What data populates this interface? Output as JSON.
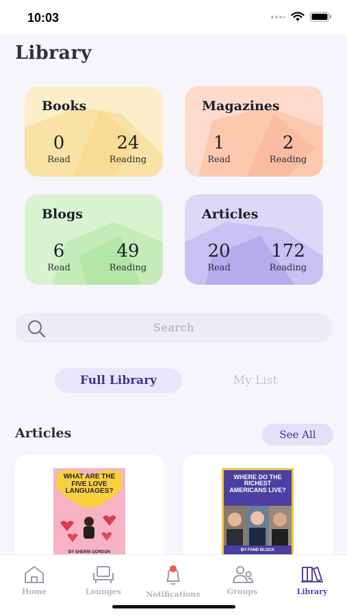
{
  "status": {
    "time": "10:03"
  },
  "page": {
    "title": "Library"
  },
  "cards": [
    {
      "title": "Books",
      "read": "0",
      "read_label": "Read",
      "reading": "24",
      "reading_label": "Reading",
      "color": "#fbe8b0"
    },
    {
      "title": "Magazines",
      "read": "1",
      "read_label": "Read",
      "reading": "2",
      "reading_label": "Reading",
      "color": "#fccfb8"
    },
    {
      "title": "Blogs",
      "read": "6",
      "read_label": "Read",
      "reading": "49",
      "reading_label": "Reading",
      "color": "#cdf0c4"
    },
    {
      "title": "Articles",
      "read": "20",
      "read_label": "Read",
      "reading": "172",
      "reading_label": "Reading",
      "color": "#d4cff6"
    }
  ],
  "search": {
    "placeholder": "Search"
  },
  "segments": {
    "full_library": "Full Library",
    "my_list": "My List"
  },
  "section": {
    "title": "Articles",
    "see_all": "See All"
  },
  "articles": [
    {
      "cover_title": "WHAT ARE THE FIVE LOVE LANGUAGES?",
      "author": "BY SHERRI GORDON",
      "bg": "#f5b3c4"
    },
    {
      "cover_title": "WHERE DO THE RICHEST AMERICANS LIVE?",
      "author": "BY FAND BLOCK",
      "bg": "#4b3fa0"
    }
  ],
  "tabs": [
    {
      "label": "Home",
      "icon": "home-icon"
    },
    {
      "label": "Lounges",
      "icon": "lounges-icon"
    },
    {
      "label": "Notifications",
      "icon": "bell-icon"
    },
    {
      "label": "Groups",
      "icon": "groups-icon"
    },
    {
      "label": "Library",
      "icon": "library-icon"
    }
  ],
  "colors": {
    "accent": "#4d44a8",
    "background": "#f6f5fc"
  }
}
